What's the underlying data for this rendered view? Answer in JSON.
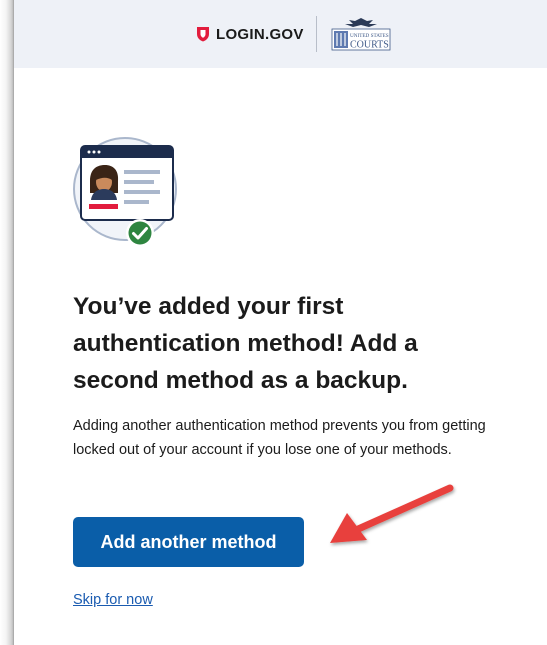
{
  "header": {
    "login_logo_text": "LOGIN.GOV",
    "partner_logo_top": "UNITED STATES",
    "partner_logo_bottom": "COURTS"
  },
  "hero": {
    "icon": "id-card-with-checkmark-icon"
  },
  "main": {
    "heading": "You’ve added your first authentication method! Add a second method as a backup.",
    "description": "Adding another authentication method prevents you from getting locked out of your account if you lose one of your methods.",
    "primary_button_label": "Add another method",
    "skip_link_label": "Skip for now"
  },
  "annotation": {
    "arrow_icon": "red-pointer-arrow-icon"
  },
  "colors": {
    "header_bg": "#eef1f7",
    "primary": "#0a5ea8",
    "link": "#1a5bb0",
    "text": "#1b1b1b",
    "login_red": "#e21c3d",
    "success_green": "#2e8540",
    "annotation_red": "#e8413c"
  }
}
